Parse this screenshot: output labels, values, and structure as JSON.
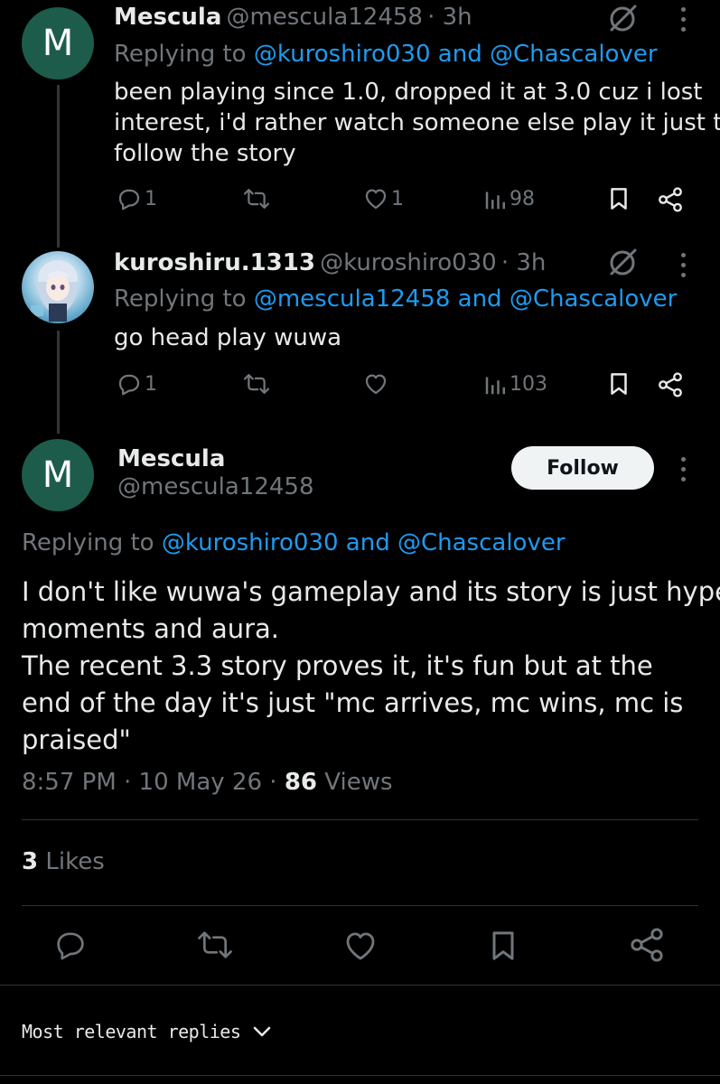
{
  "tweet1": {
    "avatar_letter": "M",
    "name": "Mescula",
    "handle": "@mescula12458",
    "time": "· 3h",
    "replying_prefix": "Replying to",
    "reply_user1": "@kuroshiro030",
    "reply_and": "and",
    "reply_user2": "@Chascalover",
    "text_line1": "been playing since 1.0, dropped it at 3.0 cuz i lost",
    "text_line2": "interest, i'd rather watch someone else play it just to",
    "text_line3": "follow the story",
    "replies": "1",
    "likes": "1",
    "views": "98"
  },
  "tweet2": {
    "name": "kuroshiru.1313",
    "handle": "@kuroshiro030",
    "time": "· 3h",
    "replying_prefix": "Replying to",
    "reply_user1": "@mescula12458",
    "reply_and": "and",
    "reply_user2": "@Chascalover",
    "text": "go head play wuwa",
    "replies": "1",
    "views": "103"
  },
  "main": {
    "avatar_letter": "M",
    "name": "Mescula",
    "handle": "@mescula12458",
    "follow_label": "Follow",
    "replying_prefix": "Replying to",
    "reply_user1": "@kuroshiro030",
    "reply_and": "and",
    "reply_user2": "@Chascalover",
    "text_line1": "I don't like wuwa's gameplay and its story is just hype",
    "text_line2": "moments and aura.",
    "text_line3": "The recent 3.3 story proves it, it's fun but at the",
    "text_line4": "end of the day it's just \"mc arrives, mc wins, mc is",
    "text_line5": "praised\"",
    "timestamp": "8:57 PM · 10 May 26 · ",
    "views_count": "86",
    "views_label": " Views",
    "likes_count": "3",
    "likes_label": " Likes"
  },
  "sort": {
    "label": "Most relevant replies"
  },
  "colors": {
    "background": "#000000",
    "text": "#e7e9ea",
    "secondary": "#71767b",
    "link": "#1d9bf0",
    "avatar_bg": "#1d5c4b"
  },
  "icons": [
    "reply-icon",
    "retweet-icon",
    "heart-icon",
    "views-icon",
    "bookmark-icon",
    "share-icon",
    "grok-icon",
    "more-icon",
    "chevron-down-icon"
  ]
}
